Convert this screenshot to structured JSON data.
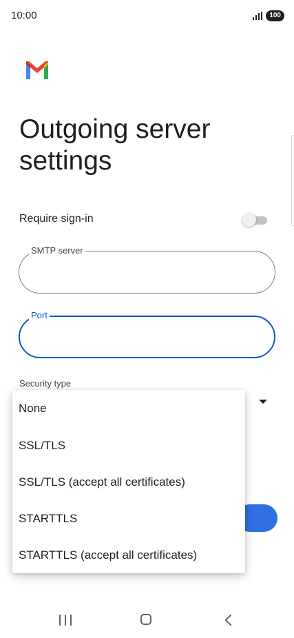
{
  "status_bar": {
    "time": "10:00",
    "battery": "100"
  },
  "app": {
    "name": "Gmail"
  },
  "page": {
    "title": "Outgoing server settings"
  },
  "require_signin": {
    "label": "Require sign-in",
    "enabled": false
  },
  "smtp_server": {
    "label": "SMTP server",
    "value": ""
  },
  "port": {
    "label": "Port",
    "value": ""
  },
  "security_type": {
    "label": "Security type",
    "options": [
      "None",
      "SSL/TLS",
      "SSL/TLS (accept all certificates)",
      "STARTTLS",
      "STARTTLS (accept all certificates)"
    ]
  },
  "colors": {
    "accent": "#0b57d0",
    "button": "#2f6fe0"
  },
  "icons": [
    "signal-icon",
    "battery-icon",
    "gmail-logo",
    "chevron-down-icon",
    "nav-recents-icon",
    "nav-home-icon",
    "nav-back-icon"
  ]
}
